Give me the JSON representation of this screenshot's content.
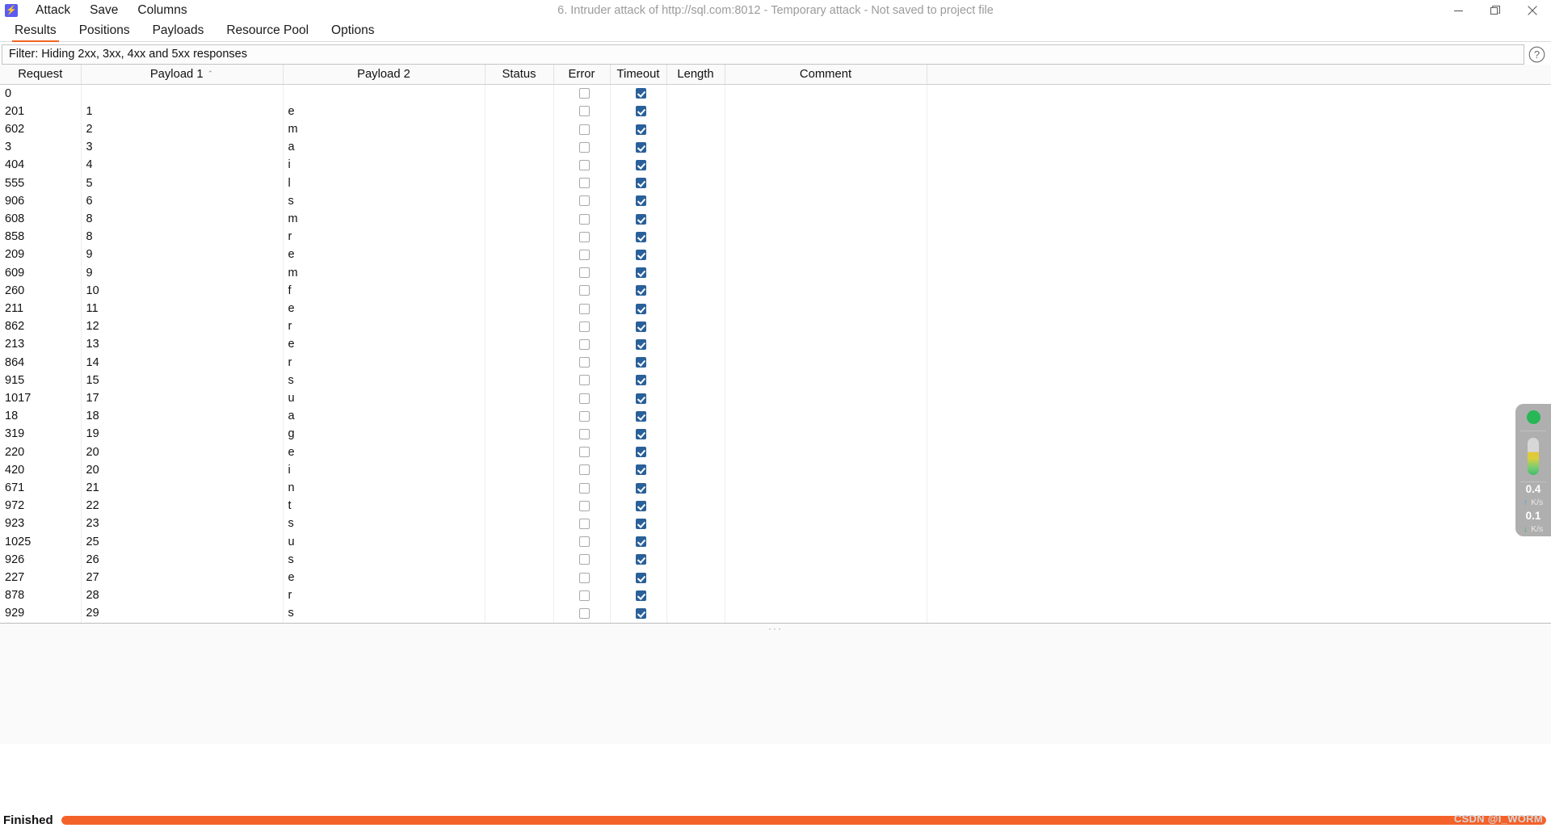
{
  "window": {
    "title": "6. Intruder attack of http://sql.com:8012 - Temporary attack - Not saved to project file",
    "app_icon": "burp-lightning-icon",
    "controls": {
      "minimize": "minimize-icon",
      "maximize": "maximize-icon",
      "close": "close-icon"
    }
  },
  "menubar": {
    "items": [
      {
        "label": "Attack"
      },
      {
        "label": "Save"
      },
      {
        "label": "Columns"
      }
    ]
  },
  "tabs": {
    "active": "Results",
    "items": [
      {
        "label": "Results"
      },
      {
        "label": "Positions"
      },
      {
        "label": "Payloads"
      },
      {
        "label": "Resource Pool"
      },
      {
        "label": "Options"
      }
    ]
  },
  "filter": {
    "text": "Filter: Hiding 2xx, 3xx, 4xx and 5xx responses",
    "help_icon": "question-mark-icon"
  },
  "table": {
    "columns": [
      {
        "key": "request",
        "label": "Request",
        "sort": ""
      },
      {
        "key": "payload1",
        "label": "Payload 1",
        "sort": "asc"
      },
      {
        "key": "payload2",
        "label": "Payload 2",
        "sort": ""
      },
      {
        "key": "status",
        "label": "Status",
        "sort": ""
      },
      {
        "key": "error",
        "label": "Error",
        "sort": ""
      },
      {
        "key": "timeout",
        "label": "Timeout",
        "sort": ""
      },
      {
        "key": "length",
        "label": "Length",
        "sort": ""
      },
      {
        "key": "comment",
        "label": "Comment",
        "sort": ""
      },
      {
        "key": "filler",
        "label": "",
        "sort": ""
      }
    ],
    "sort_caret_asc": "⌃",
    "rows": [
      {
        "request": "0",
        "payload1": "",
        "payload2": "",
        "status": "",
        "error": false,
        "timeout": true,
        "length": "",
        "comment": ""
      },
      {
        "request": "201",
        "payload1": "1",
        "payload2": "e",
        "status": "",
        "error": false,
        "timeout": true,
        "length": "",
        "comment": ""
      },
      {
        "request": "602",
        "payload1": "2",
        "payload2": "m",
        "status": "",
        "error": false,
        "timeout": true,
        "length": "",
        "comment": ""
      },
      {
        "request": "3",
        "payload1": "3",
        "payload2": "a",
        "status": "",
        "error": false,
        "timeout": true,
        "length": "",
        "comment": ""
      },
      {
        "request": "404",
        "payload1": "4",
        "payload2": "i",
        "status": "",
        "error": false,
        "timeout": true,
        "length": "",
        "comment": ""
      },
      {
        "request": "555",
        "payload1": "5",
        "payload2": "l",
        "status": "",
        "error": false,
        "timeout": true,
        "length": "",
        "comment": ""
      },
      {
        "request": "906",
        "payload1": "6",
        "payload2": "s",
        "status": "",
        "error": false,
        "timeout": true,
        "length": "",
        "comment": ""
      },
      {
        "request": "608",
        "payload1": "8",
        "payload2": "m",
        "status": "",
        "error": false,
        "timeout": true,
        "length": "",
        "comment": ""
      },
      {
        "request": "858",
        "payload1": "8",
        "payload2": "r",
        "status": "",
        "error": false,
        "timeout": true,
        "length": "",
        "comment": ""
      },
      {
        "request": "209",
        "payload1": "9",
        "payload2": "e",
        "status": "",
        "error": false,
        "timeout": true,
        "length": "",
        "comment": ""
      },
      {
        "request": "609",
        "payload1": "9",
        "payload2": "m",
        "status": "",
        "error": false,
        "timeout": true,
        "length": "",
        "comment": ""
      },
      {
        "request": "260",
        "payload1": "10",
        "payload2": "f",
        "status": "",
        "error": false,
        "timeout": true,
        "length": "",
        "comment": ""
      },
      {
        "request": "211",
        "payload1": "11",
        "payload2": "e",
        "status": "",
        "error": false,
        "timeout": true,
        "length": "",
        "comment": ""
      },
      {
        "request": "862",
        "payload1": "12",
        "payload2": "r",
        "status": "",
        "error": false,
        "timeout": true,
        "length": "",
        "comment": ""
      },
      {
        "request": "213",
        "payload1": "13",
        "payload2": "e",
        "status": "",
        "error": false,
        "timeout": true,
        "length": "",
        "comment": ""
      },
      {
        "request": "864",
        "payload1": "14",
        "payload2": "r",
        "status": "",
        "error": false,
        "timeout": true,
        "length": "",
        "comment": ""
      },
      {
        "request": "915",
        "payload1": "15",
        "payload2": "s",
        "status": "",
        "error": false,
        "timeout": true,
        "length": "",
        "comment": ""
      },
      {
        "request": "1017",
        "payload1": "17",
        "payload2": "u",
        "status": "",
        "error": false,
        "timeout": true,
        "length": "",
        "comment": ""
      },
      {
        "request": "18",
        "payload1": "18",
        "payload2": "a",
        "status": "",
        "error": false,
        "timeout": true,
        "length": "",
        "comment": ""
      },
      {
        "request": "319",
        "payload1": "19",
        "payload2": "g",
        "status": "",
        "error": false,
        "timeout": true,
        "length": "",
        "comment": ""
      },
      {
        "request": "220",
        "payload1": "20",
        "payload2": "e",
        "status": "",
        "error": false,
        "timeout": true,
        "length": "",
        "comment": ""
      },
      {
        "request": "420",
        "payload1": "20",
        "payload2": "i",
        "status": "",
        "error": false,
        "timeout": true,
        "length": "",
        "comment": ""
      },
      {
        "request": "671",
        "payload1": "21",
        "payload2": "n",
        "status": "",
        "error": false,
        "timeout": true,
        "length": "",
        "comment": ""
      },
      {
        "request": "972",
        "payload1": "22",
        "payload2": "t",
        "status": "",
        "error": false,
        "timeout": true,
        "length": "",
        "comment": ""
      },
      {
        "request": "923",
        "payload1": "23",
        "payload2": "s",
        "status": "",
        "error": false,
        "timeout": true,
        "length": "",
        "comment": ""
      },
      {
        "request": "1025",
        "payload1": "25",
        "payload2": "u",
        "status": "",
        "error": false,
        "timeout": true,
        "length": "",
        "comment": ""
      },
      {
        "request": "926",
        "payload1": "26",
        "payload2": "s",
        "status": "",
        "error": false,
        "timeout": true,
        "length": "",
        "comment": ""
      },
      {
        "request": "227",
        "payload1": "27",
        "payload2": "e",
        "status": "",
        "error": false,
        "timeout": true,
        "length": "",
        "comment": ""
      },
      {
        "request": "878",
        "payload1": "28",
        "payload2": "r",
        "status": "",
        "error": false,
        "timeout": true,
        "length": "",
        "comment": ""
      },
      {
        "request": "929",
        "payload1": "29",
        "payload2": "s",
        "status": "",
        "error": false,
        "timeout": true,
        "length": "",
        "comment": ""
      }
    ]
  },
  "splitter": {
    "handle": "···"
  },
  "statusbar": {
    "label": "Finished",
    "progress_percent": 100,
    "progress_color": "#f4622a",
    "watermark": "CSDN @I_WORM"
  },
  "net_widget": {
    "status_dot_color": "#18b24b",
    "upload_value": "0.4",
    "upload_unit": "K/s",
    "upload_arrow": "↑",
    "download_value": "0.1",
    "download_unit": "K/s",
    "download_arrow": "↓"
  }
}
